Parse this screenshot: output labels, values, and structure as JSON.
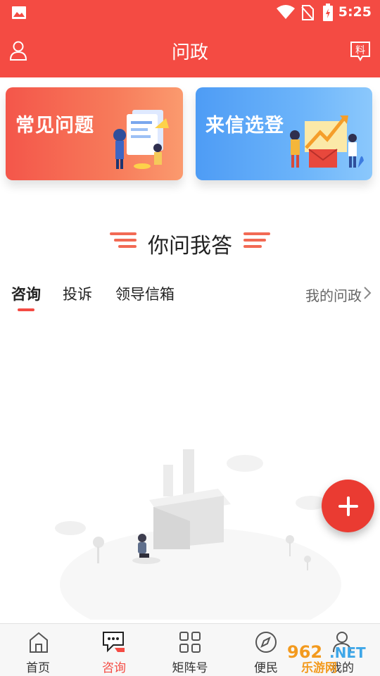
{
  "status_bar": {
    "time": "5:25",
    "icons": [
      "image-icon",
      "wifi-icon",
      "no-sim-icon",
      "battery-charging-icon"
    ]
  },
  "header": {
    "title": "问政",
    "left_icon": "user-icon",
    "right_icon": "report-icon"
  },
  "cards": [
    {
      "title": "常见问题",
      "color": "#f4564a"
    },
    {
      "title": "来信选登",
      "color": "#4e9cf5"
    }
  ],
  "section": {
    "title": "你问我答"
  },
  "tabs": {
    "items": [
      {
        "label": "咨询",
        "active": true
      },
      {
        "label": "投诉",
        "active": false
      },
      {
        "label": "领导信箱",
        "active": false
      }
    ],
    "my_link": "我的问政"
  },
  "fab": {
    "icon": "plus-icon"
  },
  "bottom_nav": {
    "items": [
      {
        "label": "首页",
        "icon": "home-icon"
      },
      {
        "label": "咨询",
        "icon": "chat-icon",
        "active": true
      },
      {
        "label": "矩阵号",
        "icon": "grid-icon"
      },
      {
        "label": "便民",
        "icon": "compass-icon"
      },
      {
        "label": "我的",
        "icon": "person-icon"
      }
    ]
  },
  "watermark": {
    "text": "乐游网"
  },
  "colors": {
    "primary": "#f44b43",
    "card_red": "#f4564a",
    "card_blue": "#4e9cf5",
    "fab": "#ea3b32"
  }
}
